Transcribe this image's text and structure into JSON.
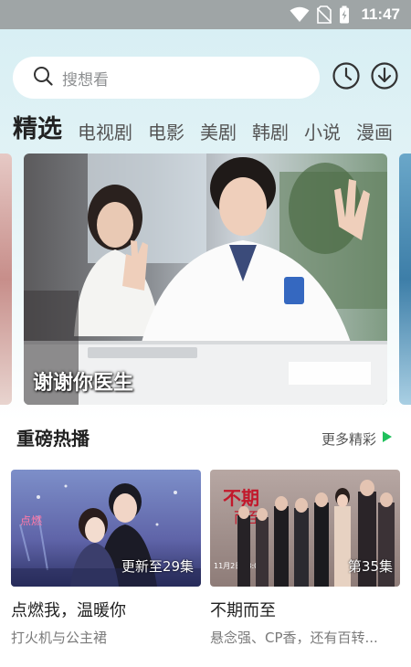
{
  "status_bar": {
    "time": "11:47"
  },
  "search": {
    "placeholder": "搜想看"
  },
  "tabs": [
    {
      "label": "精选",
      "active": true
    },
    {
      "label": "电视剧"
    },
    {
      "label": "电影"
    },
    {
      "label": "美剧"
    },
    {
      "label": "韩剧"
    },
    {
      "label": "小说"
    },
    {
      "label": "漫画"
    }
  ],
  "banner": {
    "title": "谢谢你医生"
  },
  "section": {
    "title": "重磅热播",
    "more_label": "更多精彩"
  },
  "cards": [
    {
      "name": "点燃我，温暖你",
      "desc": "打火机与公主裙",
      "episode_badge": "更新至29集"
    },
    {
      "name": "不期而至",
      "desc": "悬念强、CP香，还有百转...",
      "episode_badge": "第35集"
    }
  ],
  "colors": {
    "accent_green": "#20c05c",
    "status_bar": "#9fa5a6"
  }
}
